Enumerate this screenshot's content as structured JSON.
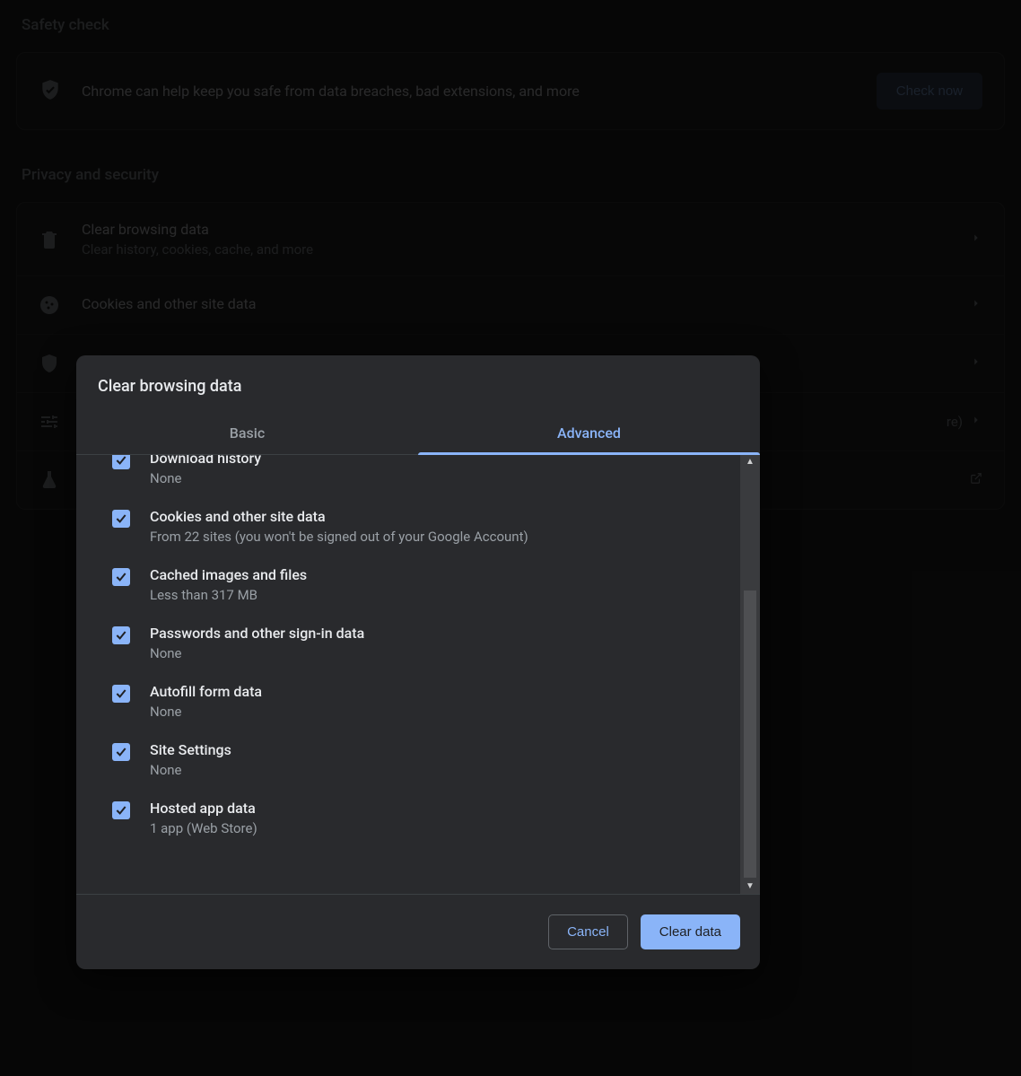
{
  "sections": {
    "safety": {
      "heading": "Safety check",
      "message": "Chrome can help keep you safe from data breaches, bad extensions, and more",
      "button": "Check now"
    },
    "privacy": {
      "heading": "Privacy and security",
      "items": [
        {
          "title": "Clear browsing data",
          "subtitle": "Clear history, cookies, cache, and more",
          "icon": "trash"
        },
        {
          "title": "Cookies and other site data",
          "subtitle": "",
          "icon": "cookie"
        },
        {
          "title": "",
          "subtitle": "",
          "icon": "shield"
        },
        {
          "title": "",
          "subtitle": "",
          "icon": "sliders",
          "tail": "re)"
        },
        {
          "title": "",
          "subtitle": "",
          "icon": "flask",
          "external": true
        }
      ]
    }
  },
  "dialog": {
    "title": "Clear browsing data",
    "tabs": {
      "basic": "Basic",
      "advanced": "Advanced",
      "active": "advanced"
    },
    "options": [
      {
        "title": "Download history",
        "subtitle": "None",
        "checked": true,
        "clipped": true
      },
      {
        "title": "Cookies and other site data",
        "subtitle": "From 22 sites (you won't be signed out of your Google Account)",
        "checked": true
      },
      {
        "title": "Cached images and files",
        "subtitle": "Less than 317 MB",
        "checked": true
      },
      {
        "title": "Passwords and other sign-in data",
        "subtitle": "None",
        "checked": true
      },
      {
        "title": "Autofill form data",
        "subtitle": "None",
        "checked": true
      },
      {
        "title": "Site Settings",
        "subtitle": "None",
        "checked": true
      },
      {
        "title": "Hosted app data",
        "subtitle": "1 app (Web Store)",
        "checked": true
      }
    ],
    "buttons": {
      "cancel": "Cancel",
      "confirm": "Clear data"
    }
  }
}
